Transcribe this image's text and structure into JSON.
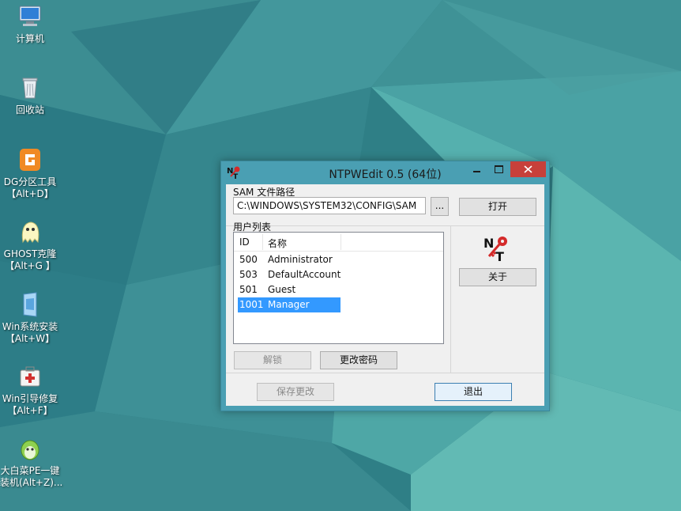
{
  "desktop": {
    "icons": [
      {
        "icon": "computer-icon",
        "lines": [
          "计算机"
        ]
      },
      {
        "icon": "recycle-bin-icon",
        "lines": [
          "回收站"
        ]
      },
      {
        "icon": "partition-tool-icon",
        "lines": [
          "DG分区工具",
          "【Alt+D】"
        ]
      },
      {
        "icon": "ghost-icon",
        "lines": [
          "GHOST克隆",
          "【Alt+G 】"
        ]
      },
      {
        "icon": "windows-install-icon",
        "lines": [
          "Win系统安装",
          "【Alt+W】"
        ]
      },
      {
        "icon": "boot-repair-icon",
        "lines": [
          "Win引导修复",
          "【Alt+F】"
        ]
      },
      {
        "icon": "dabaicai-icon",
        "lines": [
          "大白菜PE一键",
          "装机(Alt+Z)..."
        ]
      }
    ]
  },
  "window": {
    "title": "NTPWEdit 0.5 (64位)",
    "sam_group_label": "SAM 文件路径",
    "sam_path": "C:\\WINDOWS\\SYSTEM32\\CONFIG\\SAM",
    "browse_label": "...",
    "open_label": "打开",
    "users_group_label": "用户列表",
    "columns": [
      "ID",
      "名称"
    ],
    "users": [
      {
        "id": "500",
        "name": "Administrator",
        "selected": false
      },
      {
        "id": "503",
        "name": "DefaultAccount",
        "selected": false
      },
      {
        "id": "501",
        "name": "Guest",
        "selected": false
      },
      {
        "id": "1001",
        "name": "Manager",
        "selected": true
      }
    ],
    "about_label": "关于",
    "unlock_label": "解锁",
    "change_password_label": "更改密码",
    "save_label": "保存更改",
    "exit_label": "退出"
  },
  "colors": {
    "titlebar": "#4a9fb3",
    "close_button": "#c7403a",
    "selection": "#3399ff"
  }
}
